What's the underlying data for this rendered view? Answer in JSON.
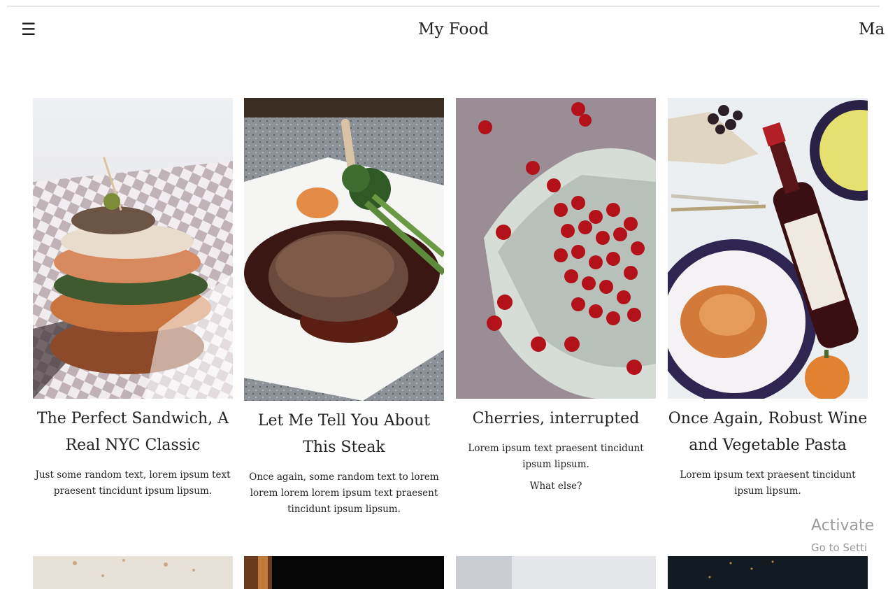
{
  "header": {
    "menu_icon": "hamburger-icon",
    "title": "My Food",
    "nav_right": "Ma"
  },
  "cards": [
    {
      "title_lines": [
        "The Perfect Sandwich, A",
        "Real NYC Classic"
      ],
      "text": "Just some random text, lorem ipsum text praesent tincidunt ipsum lipsum.",
      "image": "sandwich"
    },
    {
      "title_lines": [
        "Let Me Tell You About",
        "This Steak"
      ],
      "text": "Once again, some random text to lorem lorem lorem lorem ipsum text praesent tincidunt ipsum lipsum.",
      "image": "steak"
    },
    {
      "title_lines": [
        "Cherries, interrupted"
      ],
      "text": "Lorem ipsum text praesent tincidunt ipsum lipsum.",
      "text2": "What else?",
      "image": "cherries"
    },
    {
      "title_lines": [
        "Once Again, Robust Wine",
        "and Vegetable Pasta"
      ],
      "text": "Lorem ipsum text praesent tincidunt ipsum lipsum.",
      "image": "wine-pasta"
    }
  ],
  "watermark": {
    "line1": "Activate",
    "line2": "Go to Setti"
  }
}
